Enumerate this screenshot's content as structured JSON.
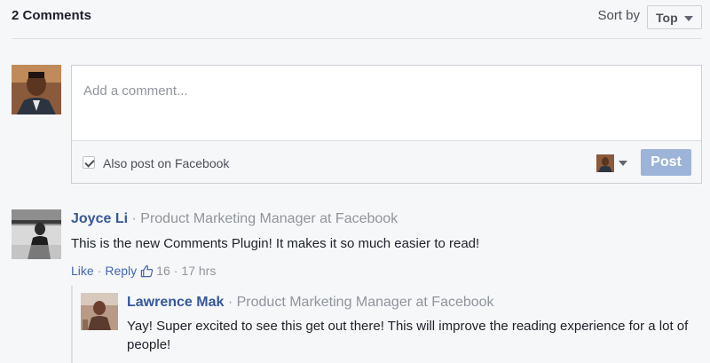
{
  "header": {
    "comment_count": "2 Comments",
    "sort_label": "Sort by",
    "sort_value": "Top"
  },
  "composer": {
    "placeholder": "Add a comment...",
    "also_post_label": "Also post on Facebook",
    "also_post_checked": true,
    "post_label": "Post"
  },
  "comments": [
    {
      "author": "Joyce Li",
      "separator": "·",
      "role": "Product Marketing Manager at Facebook",
      "text": "This is the new Comments Plugin! It makes it so much easier to read!",
      "like_label": "Like",
      "dot": "·",
      "reply_label": "Reply",
      "like_count": "16",
      "time": "17 hrs"
    }
  ],
  "replies": [
    {
      "author": "Lawrence Mak",
      "separator": "·",
      "role": "Product Marketing Manager at Facebook",
      "text": "Yay! Super excited to see this get out there! This will improve the reading experience for a lot of people!"
    }
  ],
  "colors": {
    "link": "#365899",
    "post_button": "#9cb4d8",
    "muted": "#90949c"
  }
}
